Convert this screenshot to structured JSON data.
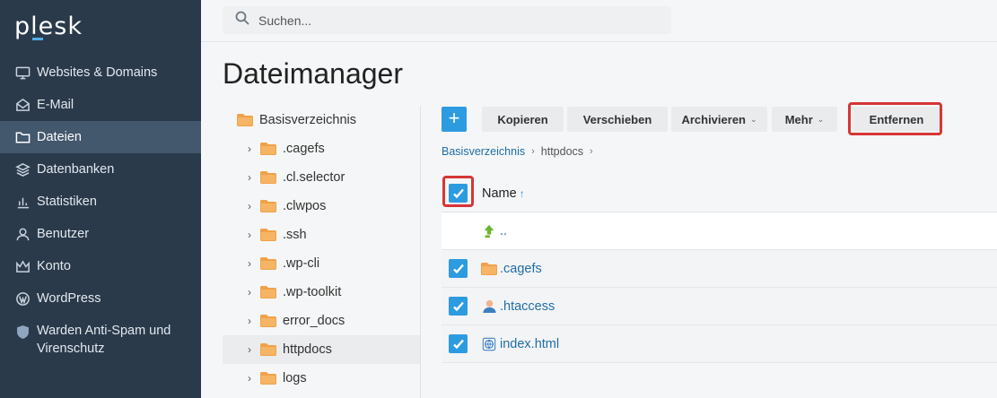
{
  "app": {
    "logo_text": "plesk"
  },
  "sidebar": {
    "items": [
      {
        "label": "Websites & Domains",
        "icon": "monitor-icon",
        "active": false
      },
      {
        "label": "E-Mail",
        "icon": "mail-icon",
        "active": false
      },
      {
        "label": "Dateien",
        "icon": "folder-icon",
        "active": true
      },
      {
        "label": "Datenbanken",
        "icon": "database-icon",
        "active": false
      },
      {
        "label": "Statistiken",
        "icon": "bar-chart-icon",
        "active": false
      },
      {
        "label": "Benutzer",
        "icon": "user-icon",
        "active": false
      },
      {
        "label": "Konto",
        "icon": "crown-icon",
        "active": false
      },
      {
        "label": "WordPress",
        "icon": "wordpress-icon",
        "active": false
      },
      {
        "label": "Warden Anti-Spam und Virenschutz",
        "icon": "shield-icon",
        "active": false
      }
    ]
  },
  "search": {
    "placeholder": "Suchen..."
  },
  "page": {
    "title": "Dateimanager"
  },
  "tree": {
    "root": "Basisverzeichnis",
    "children": [
      ".cagefs",
      ".cl.selector",
      ".clwpos",
      ".ssh",
      ".wp-cli",
      ".wp-toolkit",
      "error_docs",
      "httpdocs",
      "logs"
    ],
    "active": "httpdocs"
  },
  "toolbar": {
    "add_label": "+",
    "copy": "Kopieren",
    "move": "Verschieben",
    "archive": "Archivieren",
    "more": "Mehr",
    "remove": "Entfernen"
  },
  "breadcrumb": {
    "root": "Basisverzeichnis",
    "current": "httpdocs"
  },
  "table": {
    "header_name": "Name",
    "sort_arrow": "↑",
    "up_label": "..",
    "rows": [
      {
        "name": ".cagefs",
        "type": "folder",
        "checked": true
      },
      {
        "name": ".htaccess",
        "type": "user-file",
        "checked": true
      },
      {
        "name": "index.html",
        "type": "html-file",
        "checked": true
      }
    ]
  },
  "colors": {
    "accent": "#2d9be0",
    "sidebar_bg": "#2a3a4b",
    "highlight": "#d63636",
    "folder": "#f0a24a"
  }
}
